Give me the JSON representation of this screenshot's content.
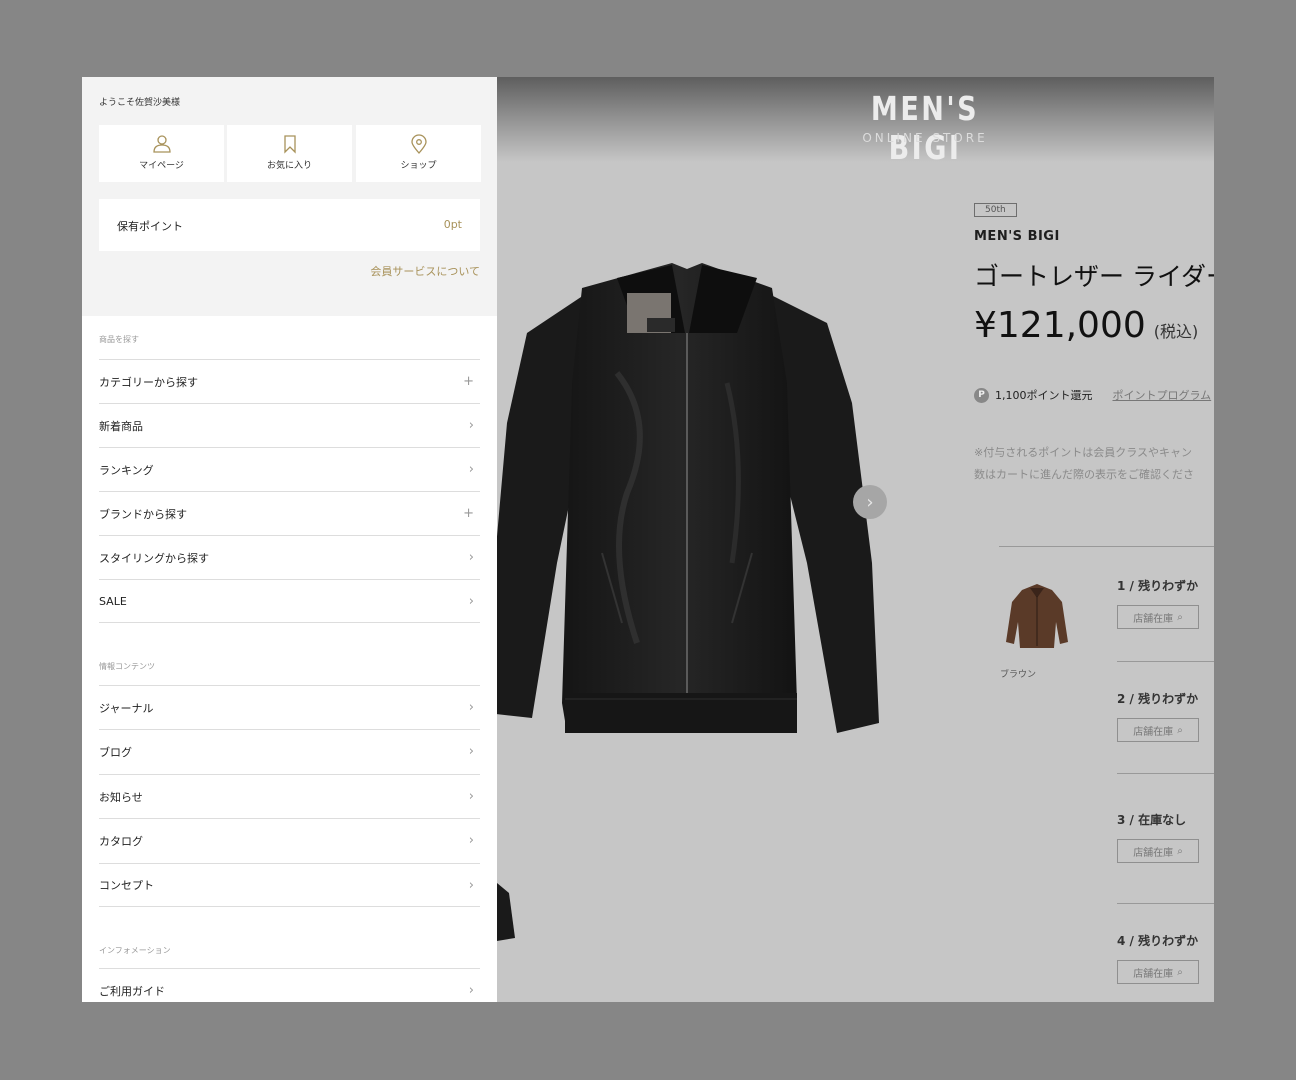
{
  "drawer": {
    "welcome": "ようこそ佐賀沙美様",
    "quick_links": [
      {
        "label": "マイページ",
        "icon": "user-icon"
      },
      {
        "label": "お気に入り",
        "icon": "bookmark-icon"
      },
      {
        "label": "ショップ",
        "icon": "map-pin-icon"
      }
    ],
    "points_label": "保有ポイント",
    "points_value": "0pt",
    "member_link": "会員サービスについて",
    "sections": [
      {
        "label": "商品を探す",
        "items": [
          {
            "label": "カテゴリーから探す",
            "icon": "plus-icon"
          },
          {
            "label": "新着商品",
            "icon": "chevron-right-icon"
          },
          {
            "label": "ランキング",
            "icon": "chevron-right-icon"
          },
          {
            "label": "ブランドから探す",
            "icon": "plus-icon"
          },
          {
            "label": "スタイリングから探す",
            "icon": "chevron-right-icon"
          },
          {
            "label": "SALE",
            "icon": "chevron-right-icon"
          }
        ]
      },
      {
        "label": "情報コンテンツ",
        "items": [
          {
            "label": "ジャーナル",
            "icon": "chevron-right-icon"
          },
          {
            "label": "ブログ",
            "icon": "chevron-right-icon"
          },
          {
            "label": "お知らせ",
            "icon": "chevron-right-icon"
          },
          {
            "label": "カタログ",
            "icon": "chevron-right-icon"
          },
          {
            "label": "コンセプト",
            "icon": "chevron-right-icon"
          }
        ]
      },
      {
        "label": "インフォメーション",
        "items": [
          {
            "label": "ご利用ガイド",
            "icon": "chevron-right-icon"
          }
        ]
      }
    ],
    "accent_color": "#a8925a"
  },
  "header": {
    "logo": "MEN'S BIGI",
    "logo_sub": "ONLINE STORE"
  },
  "product": {
    "badge": "50th",
    "brand": "MEN'S BIGI",
    "title": "ゴートレザー ライダー",
    "price": "¥121,000",
    "tax": "(税込)",
    "points": "1,100ポイント還元",
    "points_icon_letter": "P",
    "points_link": "ポイントプログラム",
    "note_line1": "※付与されるポイントは会員クラスやキャン",
    "note_line2": "数はカートに進んだ際の表示をご確認くださ",
    "color_label": "ブラウン",
    "stock_button_label": "店舗在庫",
    "sizes": [
      {
        "label": "1 / 残りわずか"
      },
      {
        "label": "2 / 残りわずか"
      },
      {
        "label": "3 / 在庫なし"
      },
      {
        "label": "4 / 残りわずか"
      }
    ]
  }
}
